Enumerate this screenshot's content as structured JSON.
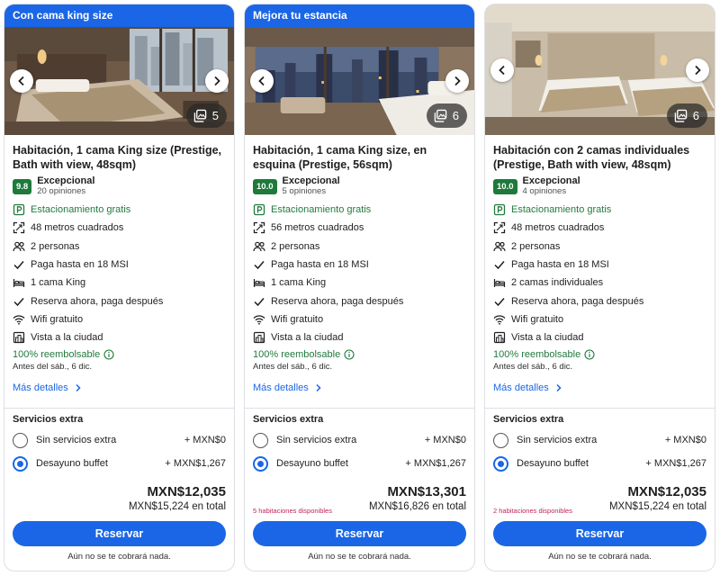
{
  "colors": {
    "accent": "#1a66e6",
    "score_badge": "#1d7a3a",
    "positive_green": "#227a3d",
    "availability_red": "#c0245a"
  },
  "cards": [
    {
      "banner": "Con cama king size",
      "photo_count": "5",
      "title": "Habitación, 1 cama King size (Prestige, Bath with view, 48sqm)",
      "score": "9.8",
      "rating_label": "Excepcional",
      "reviews": "20 opiniones",
      "amenities": [
        {
          "icon": "parking-icon",
          "text": "Estacionamiento gratis"
        },
        {
          "icon": "square-meters-icon",
          "text": "48 metros cuadrados"
        },
        {
          "icon": "people-icon",
          "text": "2 personas"
        },
        {
          "icon": "checkmark-icon",
          "text": "Paga hasta en 18 MSI"
        },
        {
          "icon": "bed-icon",
          "text": "1 cama King"
        },
        {
          "icon": "checkmark-icon",
          "text": "Reserva ahora, paga después"
        },
        {
          "icon": "wifi-icon",
          "text": "Wifi gratuito"
        },
        {
          "icon": "city-view-icon",
          "text": "Vista a la ciudad"
        }
      ],
      "refund": "100% reembolsable",
      "refund_date": "Antes del sáb., 6 dic.",
      "details_link": "Más detalles",
      "extras_title": "Servicios extra",
      "options": [
        {
          "label": "Sin servicios extra",
          "price": "+ MXN$0",
          "selected": false
        },
        {
          "label": "Desayuno buffet",
          "price": "+ MXN$1,267",
          "selected": true
        }
      ],
      "availability": "",
      "price": "MXN$12,035",
      "price_total": "MXN$15,224 en total",
      "reserve_label": "Reservar",
      "note": "Aún no se te cobrará nada."
    },
    {
      "banner": "Mejora tu estancia",
      "photo_count": "6",
      "title": "Habitación, 1 cama King size, en esquina (Prestige, 56sqm)",
      "score": "10.0",
      "rating_label": "Excepcional",
      "reviews": "5 opiniones",
      "amenities": [
        {
          "icon": "parking-icon",
          "text": "Estacionamiento gratis"
        },
        {
          "icon": "square-meters-icon",
          "text": "56 metros cuadrados"
        },
        {
          "icon": "people-icon",
          "text": "2 personas"
        },
        {
          "icon": "checkmark-icon",
          "text": "Paga hasta en 18 MSI"
        },
        {
          "icon": "bed-icon",
          "text": "1 cama King"
        },
        {
          "icon": "checkmark-icon",
          "text": "Reserva ahora, paga después"
        },
        {
          "icon": "wifi-icon",
          "text": "Wifi gratuito"
        },
        {
          "icon": "city-view-icon",
          "text": "Vista a la ciudad"
        }
      ],
      "refund": "100% reembolsable",
      "refund_date": "Antes del sáb., 6 dic.",
      "details_link": "Más detalles",
      "extras_title": "Servicios extra",
      "options": [
        {
          "label": "Sin servicios extra",
          "price": "+ MXN$0",
          "selected": false
        },
        {
          "label": "Desayuno buffet",
          "price": "+ MXN$1,267",
          "selected": true
        }
      ],
      "availability": "5 habitaciones disponibles",
      "price": "MXN$13,301",
      "price_total": "MXN$16,826 en total",
      "reserve_label": "Reservar",
      "note": "Aún no se te cobrará nada."
    },
    {
      "banner": "",
      "photo_count": "6",
      "title": "Habitación con 2 camas individuales (Prestige, Bath with view, 48sqm)",
      "score": "10.0",
      "rating_label": "Excepcional",
      "reviews": "4 opiniones",
      "amenities": [
        {
          "icon": "parking-icon",
          "text": "Estacionamiento gratis"
        },
        {
          "icon": "square-meters-icon",
          "text": "48 metros cuadrados"
        },
        {
          "icon": "people-icon",
          "text": "2 personas"
        },
        {
          "icon": "checkmark-icon",
          "text": "Paga hasta en 18 MSI"
        },
        {
          "icon": "bed-icon",
          "text": "2 camas individuales"
        },
        {
          "icon": "checkmark-icon",
          "text": "Reserva ahora, paga después"
        },
        {
          "icon": "wifi-icon",
          "text": "Wifi gratuito"
        },
        {
          "icon": "city-view-icon",
          "text": "Vista a la ciudad"
        }
      ],
      "refund": "100% reembolsable",
      "refund_date": "Antes del sáb., 6 dic.",
      "details_link": "Más detalles",
      "extras_title": "Servicios extra",
      "options": [
        {
          "label": "Sin servicios extra",
          "price": "+ MXN$0",
          "selected": false
        },
        {
          "label": "Desayuno buffet",
          "price": "+ MXN$1,267",
          "selected": true
        }
      ],
      "availability": "2 habitaciones disponibles",
      "price": "MXN$12,035",
      "price_total": "MXN$15,224 en total",
      "reserve_label": "Reservar",
      "note": "Aún no se te cobrará nada."
    }
  ]
}
